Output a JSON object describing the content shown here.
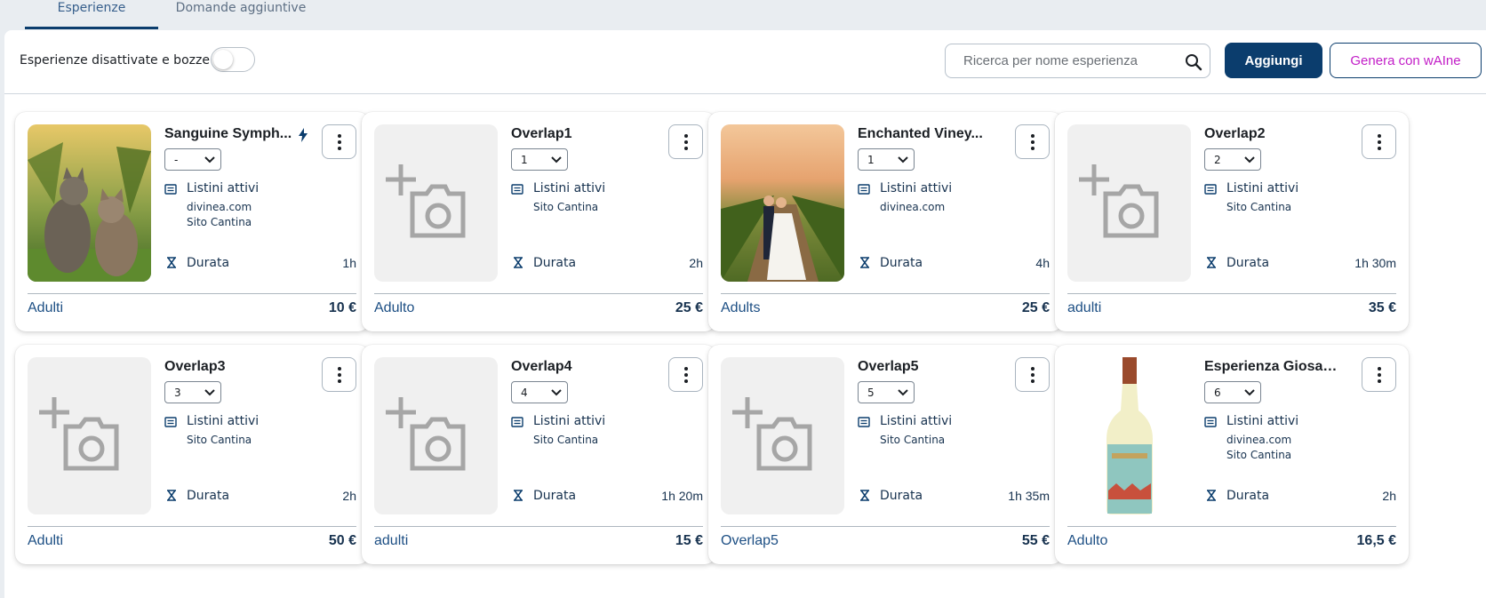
{
  "tabs": [
    {
      "label": "Esperienze",
      "active": true
    },
    {
      "label": "Domande aggiuntive",
      "active": false
    }
  ],
  "toolbar": {
    "toggle_label": "Esperienze disattivate e bozze",
    "toggle_on": false,
    "search_placeholder": "Ricerca per nome esperienza",
    "add_label": "Aggiungi",
    "generate_label": "Genera con wAIne"
  },
  "colors": {
    "primary": "#0b3d6d",
    "generate_text": "#c21dc7",
    "page_bg": "#e9edf1"
  },
  "cards": [
    {
      "title": "Sanguine Symph...",
      "icons": [
        "bolt-icon"
      ],
      "select": "-",
      "listini": "Listini attivi",
      "channels": [
        "divinea.com",
        "Sito Cantina"
      ],
      "duration_label": "Durata",
      "duration": "1h",
      "price_label": "Adulti",
      "price": "10 €",
      "image": "cats-vineyard-photo"
    },
    {
      "title": "Overlap1",
      "select": "1",
      "listini": "Listini attivi",
      "channels": [
        "Sito Cantina"
      ],
      "duration_label": "Durata",
      "duration": "2h",
      "price_label": "Adulto",
      "price": "25 €",
      "image": "add-photo-placeholder"
    },
    {
      "title": "Enchanted Viney...",
      "select": "1",
      "listini": "Listini attivi",
      "channels": [
        "divinea.com"
      ],
      "duration_label": "Durata",
      "duration": "4h",
      "price_label": "Adults",
      "price": "25 €",
      "image": "wedding-vineyard-photo"
    },
    {
      "title": "Overlap2",
      "select": "2",
      "listini": "Listini attivi",
      "channels": [
        "Sito Cantina"
      ],
      "duration_label": "Durata",
      "duration": "1h 30m",
      "price_label": "adulti",
      "price": "35 €",
      "image": "add-photo-placeholder"
    },
    {
      "title": "Overlap3",
      "select": "3",
      "listini": "Listini attivi",
      "channels": [
        "Sito Cantina"
      ],
      "duration_label": "Durata",
      "duration": "2h",
      "price_label": "Adulti",
      "price": "50 €",
      "image": "add-photo-placeholder"
    },
    {
      "title": "Overlap4",
      "select": "4",
      "listini": "Listini attivi",
      "channels": [
        "Sito Cantina"
      ],
      "duration_label": "Durata",
      "duration": "1h 20m",
      "price_label": "adulti",
      "price": "15 €",
      "image": "add-photo-placeholder"
    },
    {
      "title": "Overlap5",
      "select": "5",
      "listini": "Listini attivi",
      "channels": [
        "Sito Cantina"
      ],
      "duration_label": "Durata",
      "duration": "1h 35m",
      "price_label": "Overlap5",
      "price": "55 €",
      "image": "add-photo-placeholder"
    },
    {
      "title": "Esperienza Giosa ...",
      "select": "6",
      "listini": "Listini attivi",
      "channels": [
        "divinea.com",
        "Sito Cantina"
      ],
      "duration_label": "Durata",
      "duration": "2h",
      "price_label": "Adulto",
      "price": "16,5 €",
      "image": "wine-bottle-photo"
    }
  ]
}
